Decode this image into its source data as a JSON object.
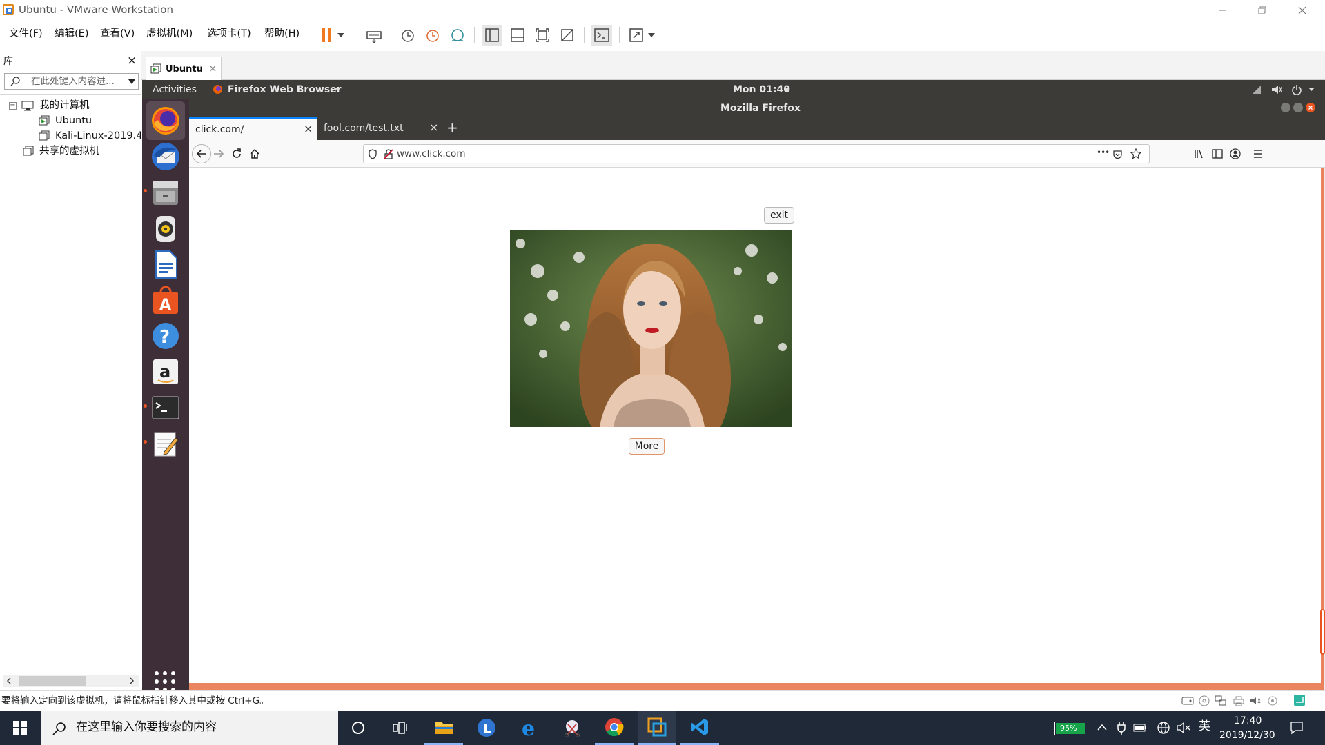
{
  "window": {
    "title": "Ubuntu - VMware Workstation"
  },
  "menu": {
    "items": [
      "文件(F)",
      "编辑(E)",
      "查看(V)",
      "虚拟机(M)",
      "选项卡(T)",
      "帮助(H)"
    ]
  },
  "library": {
    "title": "库",
    "close": "×",
    "search_placeholder": "在此处键入内容进...",
    "tree": {
      "my_computer": "我的计算机",
      "ubuntu": "Ubuntu",
      "kali": "Kali-Linux-2019.4",
      "shared": "共享的虚拟机"
    }
  },
  "vm_tab": {
    "label": "Ubuntu",
    "close": "×"
  },
  "gnome": {
    "activities": "Activities",
    "app_menu": "Firefox Web Browser",
    "clock": "Mon 01:40"
  },
  "firefox": {
    "window_title": "Mozilla Firefox",
    "tabs": [
      {
        "label": "click.com/",
        "close": "×"
      },
      {
        "label": "fool.com/test.txt",
        "close": "×"
      }
    ],
    "new_tab": "+",
    "url": "www.click.com",
    "page_actions": "•••"
  },
  "page": {
    "exit_label": "exit",
    "more_label": "More"
  },
  "status": {
    "message": "要将输入定向到该虚拟机，请将鼠标指针移入其中或按 Ctrl+G。"
  },
  "taskbar": {
    "search_placeholder": "在这里输入你要搜索的内容",
    "battery": "95%",
    "ime": "英",
    "time": "17:40",
    "date": "2019/12/30"
  },
  "colors": {
    "ubuntu_orange": "#e95420",
    "dock": "#3d2e38",
    "panel": "#3c3b37",
    "taskbar": "#1f2937"
  }
}
